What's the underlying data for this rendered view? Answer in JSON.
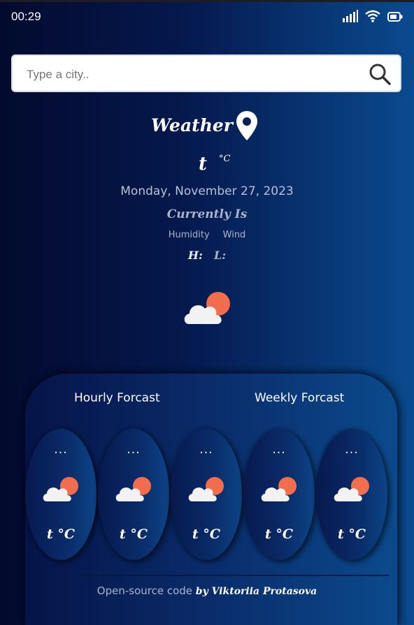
{
  "status_bar": {
    "time": "00:29",
    "icons": [
      "signal-icon",
      "wifi-icon",
      "battery-icon"
    ]
  },
  "search": {
    "placeholder": "Type a city..",
    "value": "",
    "icon": "search-icon"
  },
  "header": {
    "title": "Weather",
    "location_icon": "map-pin-icon"
  },
  "current": {
    "temp": "t",
    "unit": "°C",
    "date": "Monday, November 27, 2023",
    "currently_label": "Currently Is",
    "humidity_label": "Humidity",
    "wind_label": "Wind",
    "high_label": "H:",
    "low_label": "L:",
    "icon": "cloud-sun-icon"
  },
  "forecast": {
    "tabs": [
      {
        "label": "Hourly Forcast"
      },
      {
        "label": "Weekly Forcast"
      }
    ],
    "cards": [
      {
        "time": "...",
        "temp": "t °C",
        "icon": "cloud-sun-icon"
      },
      {
        "time": "...",
        "temp": "t °C",
        "icon": "cloud-sun-icon"
      },
      {
        "time": "...",
        "temp": "t °C",
        "icon": "cloud-sun-icon"
      },
      {
        "time": "...",
        "temp": "t °C",
        "icon": "cloud-sun-icon"
      },
      {
        "time": "...",
        "temp": "t °C",
        "icon": "cloud-sun-icon"
      }
    ]
  },
  "footer": {
    "text": "Open-source code",
    "author": "by Viktoriia Protasova"
  },
  "colors": {
    "background_dark": "#030a2e",
    "background_light": "#0a4a8e",
    "sun": "#f26d4b",
    "cloud": "#f2f2f2"
  }
}
